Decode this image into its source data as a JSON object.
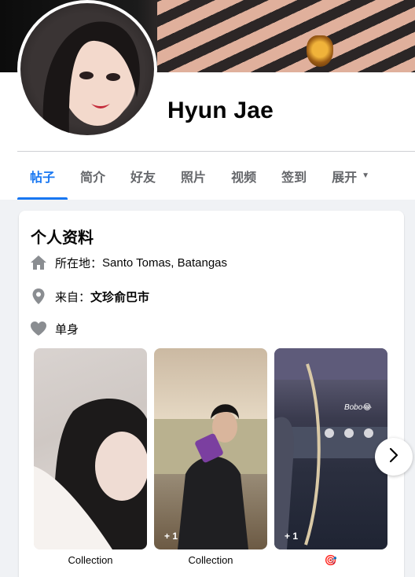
{
  "profile": {
    "name": "Hyun Jae"
  },
  "tabs": [
    {
      "label": "帖子",
      "active": true
    },
    {
      "label": "简介",
      "active": false
    },
    {
      "label": "好友",
      "active": false
    },
    {
      "label": "照片",
      "active": false
    },
    {
      "label": "视频",
      "active": false
    },
    {
      "label": "签到",
      "active": false
    },
    {
      "label": "展开",
      "active": false
    }
  ],
  "intro": {
    "title": "个人资料",
    "location_prefix": "所在地：",
    "location_value": "Santo Tomas, Batangas",
    "from_prefix": "来自：",
    "from_value": "文珍俞巴市",
    "relationship": "单身"
  },
  "highlights": [
    {
      "caption": "Collection",
      "extra": ""
    },
    {
      "caption": "Collection",
      "extra": "+ 1"
    },
    {
      "caption": "🎯",
      "extra": "+ 1",
      "overlay_text": "Bobo😂"
    }
  ],
  "colors": {
    "accent": "#1877f2",
    "muted": "#65676b",
    "icon_gray": "#8a8d91",
    "background": "#f0f2f5"
  },
  "icons": {
    "location": "home-icon",
    "from": "map-pin-icon",
    "relationship": "heart-icon",
    "more": "caret-down-icon",
    "next": "chevron-right-icon"
  }
}
